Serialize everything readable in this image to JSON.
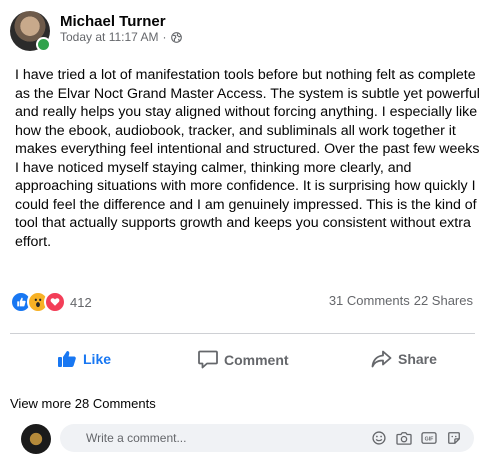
{
  "post": {
    "author": "Michael Turner",
    "timestamp": "Today at 11:17 AM",
    "separator": "·",
    "audience_icon": "globe-icon",
    "text": "I have tried a lot of manifestation tools before but nothing felt as complete as the Elvar Noct Grand Master Access. The system is subtle yet powerful and really helps you stay aligned without forcing anything. I especially like how the ebook, audiobook, tracker, and subliminals all work together it makes everything feel intentional and structured. Over the past few weeks I have noticed myself staying calmer, thinking more clearly, and approaching situations with more confidence. It is surprising how quickly I could feel the difference and I am genuinely impressed. This is the kind of tool that actually supports growth and keeps you consistent without extra effort."
  },
  "reactions": {
    "icons": [
      "like-icon",
      "wow-icon",
      "love-icon"
    ],
    "count": "412",
    "comments": "31 Comments",
    "shares": "22 Shares"
  },
  "actions": {
    "like": "Like",
    "comment": "Comment",
    "share": "Share"
  },
  "comments": {
    "view_more": "View more 28 Comments",
    "placeholder": "Write a comment..."
  },
  "colors": {
    "accent": "#1877f2",
    "muted": "#65676b",
    "online": "#31a24c"
  }
}
